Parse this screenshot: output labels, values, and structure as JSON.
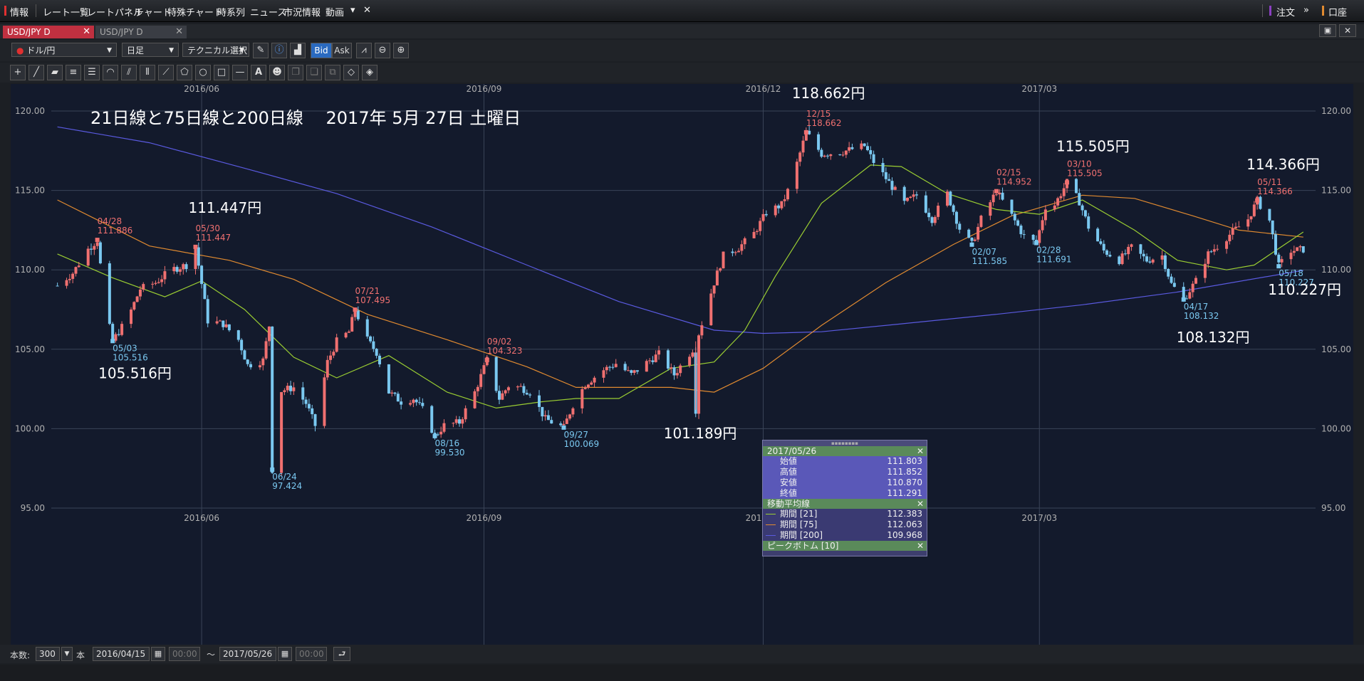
{
  "menu": {
    "items": [
      "情報",
      "レート一覧",
      "レートパネル",
      "チャート",
      "特殊チャート",
      "時系列",
      "ニュース",
      "市況情報",
      "動画"
    ],
    "right_items": [
      "注文",
      "口座"
    ]
  },
  "tabs": [
    {
      "label": "USD/JPY D",
      "active": true
    },
    {
      "label": "USD/JPY D",
      "active": false
    }
  ],
  "toolbar": {
    "pair_select": "ドル/円",
    "period_select": "日足",
    "technical_select": "テクニカル選択",
    "bid_label": "Bid",
    "ask_label": "Ask"
  },
  "status": {
    "count_label": "本数:",
    "count_value": "300",
    "count_unit": "本",
    "from_date": "2016/04/15",
    "from_time": "00:00",
    "tilde": "〜",
    "to_date": "2017/05/26",
    "to_time": "00:00"
  },
  "panel": {
    "date": "2017/05/26",
    "ohlc": [
      {
        "label": "始値",
        "value": "111.803"
      },
      {
        "label": "高値",
        "value": "111.852"
      },
      {
        "label": "安値",
        "value": "110.870"
      },
      {
        "label": "終値",
        "value": "111.291"
      }
    ],
    "ma_title": "移動平均線",
    "ma_rows": [
      {
        "label": "期間 [21]",
        "value": "112.383",
        "color": "#9acd32"
      },
      {
        "label": "期間 [75]",
        "value": "112.063",
        "color": "#e08a30"
      },
      {
        "label": "期間 [200]",
        "value": "109.968",
        "color": "#5a5ae0"
      }
    ],
    "peak_title": "ピークボトム [10]"
  },
  "chart_data": {
    "type": "candlestick",
    "title": "21日線と75日線と200日線　 2017年 5月 27日 土曜日",
    "ylim": [
      95,
      121.5
    ],
    "y_ticks": [
      "95.00",
      "100.00",
      "105.00",
      "110.00",
      "115.00",
      "120.00"
    ],
    "x_ticks": [
      "2016/06",
      "2016/09",
      "2016/12",
      "2017/03"
    ],
    "grid": true,
    "up_color": "#f07070",
    "down_color": "#7ac8f0",
    "ma_colors": {
      "ma21": "#9acd32",
      "ma75": "#e08a30",
      "ma200": "#5a5ae0"
    },
    "price_path": [
      [
        "2016-04-15",
        109.0
      ],
      [
        "2016-04-20",
        109.8
      ],
      [
        "2016-04-25",
        111.3
      ],
      [
        "2016-04-28",
        111.886
      ],
      [
        "2016-05-01",
        107.2
      ],
      [
        "2016-05-03",
        105.516
      ],
      [
        "2016-05-08",
        107.0
      ],
      [
        "2016-05-12",
        108.8
      ],
      [
        "2016-05-17",
        109.2
      ],
      [
        "2016-05-22",
        110.0
      ],
      [
        "2016-05-27",
        110.3
      ],
      [
        "2016-05-30",
        111.447
      ],
      [
        "2016-06-03",
        106.8
      ],
      [
        "2016-06-08",
        106.6
      ],
      [
        "2016-06-13",
        105.6
      ],
      [
        "2016-06-16",
        104.0
      ],
      [
        "2016-06-21",
        104.3
      ],
      [
        "2016-06-23",
        106.5
      ],
      [
        "2016-06-24",
        97.424
      ],
      [
        "2016-06-27",
        102.4
      ],
      [
        "2016-07-01",
        102.6
      ],
      [
        "2016-07-05",
        101.6
      ],
      [
        "2016-07-08",
        100.2
      ],
      [
        "2016-07-12",
        104.2
      ],
      [
        "2016-07-15",
        105.5
      ],
      [
        "2016-07-19",
        106.1
      ],
      [
        "2016-07-21",
        107.495
      ],
      [
        "2016-07-25",
        105.6
      ],
      [
        "2016-07-28",
        104.8
      ],
      [
        "2016-08-01",
        102.3
      ],
      [
        "2016-08-05",
        101.7
      ],
      [
        "2016-08-09",
        101.9
      ],
      [
        "2016-08-12",
        101.2
      ],
      [
        "2016-08-16",
        99.53
      ],
      [
        "2016-08-19",
        100.2
      ],
      [
        "2016-08-24",
        100.4
      ],
      [
        "2016-08-29",
        102.3
      ],
      [
        "2016-09-02",
        104.323
      ],
      [
        "2016-09-06",
        101.9
      ],
      [
        "2016-09-09",
        102.7
      ],
      [
        "2016-09-13",
        102.6
      ],
      [
        "2016-09-16",
        102.3
      ],
      [
        "2016-09-21",
        100.6
      ],
      [
        "2016-09-27",
        100.069
      ],
      [
        "2016-09-30",
        101.5
      ],
      [
        "2016-10-04",
        102.8
      ],
      [
        "2016-10-10",
        103.7
      ],
      [
        "2016-10-14",
        104.1
      ],
      [
        "2016-10-19",
        103.4
      ],
      [
        "2016-10-25",
        104.3
      ],
      [
        "2016-10-28",
        104.7
      ],
      [
        "2016-11-02",
        103.4
      ],
      [
        "2016-11-08",
        105.0
      ],
      [
        "2016-11-09",
        101.189
      ],
      [
        "2016-11-10",
        106.0
      ],
      [
        "2016-11-15",
        109.2
      ],
      [
        "2016-11-18",
        110.9
      ],
      [
        "2016-11-23",
        111.4
      ],
      [
        "2016-11-28",
        112.3
      ],
      [
        "2016-12-02",
        113.6
      ],
      [
        "2016-12-07",
        114.1
      ],
      [
        "2016-12-10",
        115.4
      ],
      [
        "2016-12-15",
        118.662
      ],
      [
        "2016-12-20",
        117.3
      ],
      [
        "2016-12-26",
        117.4
      ],
      [
        "2017-01-03",
        117.8
      ],
      [
        "2017-01-06",
        116.8
      ],
      [
        "2017-01-11",
        115.5
      ],
      [
        "2017-01-16",
        114.2
      ],
      [
        "2017-01-20",
        114.7
      ],
      [
        "2017-01-25",
        113.2
      ],
      [
        "2017-01-30",
        114.8
      ],
      [
        "2017-02-03",
        112.6
      ],
      [
        "2017-02-07",
        111.585
      ],
      [
        "2017-02-10",
        113.2
      ],
      [
        "2017-02-15",
        114.952
      ],
      [
        "2017-02-20",
        113.4
      ],
      [
        "2017-02-24",
        112.1
      ],
      [
        "2017-02-28",
        111.691
      ],
      [
        "2017-03-03",
        114.0
      ],
      [
        "2017-03-06",
        114.1
      ],
      [
        "2017-03-10",
        115.505
      ],
      [
        "2017-03-14",
        114.3
      ],
      [
        "2017-03-17",
        112.7
      ],
      [
        "2017-03-22",
        111.2
      ],
      [
        "2017-03-27",
        110.6
      ],
      [
        "2017-03-31",
        111.4
      ],
      [
        "2017-04-05",
        110.6
      ],
      [
        "2017-04-10",
        110.9
      ],
      [
        "2017-04-13",
        109.1
      ],
      [
        "2017-04-17",
        108.132
      ],
      [
        "2017-04-21",
        109.3
      ],
      [
        "2017-04-25",
        111.0
      ],
      [
        "2017-04-28",
        111.5
      ],
      [
        "2017-05-03",
        112.4
      ],
      [
        "2017-05-08",
        113.2
      ],
      [
        "2017-05-11",
        114.366
      ],
      [
        "2017-05-15",
        113.1
      ],
      [
        "2017-05-18",
        110.227
      ],
      [
        "2017-05-22",
        111.2
      ],
      [
        "2017-05-26",
        111.291
      ]
    ],
    "ma21_path": [
      [
        "2016-04-15",
        111.0
      ],
      [
        "2016-05-03",
        109.5
      ],
      [
        "2016-05-20",
        108.3
      ],
      [
        "2016-06-01",
        109.3
      ],
      [
        "2016-06-15",
        107.5
      ],
      [
        "2016-07-01",
        104.5
      ],
      [
        "2016-07-15",
        103.2
      ],
      [
        "2016-08-01",
        104.6
      ],
      [
        "2016-08-20",
        102.3
      ],
      [
        "2016-09-05",
        101.3
      ],
      [
        "2016-09-20",
        101.7
      ],
      [
        "2016-10-01",
        101.9
      ],
      [
        "2016-10-15",
        101.9
      ],
      [
        "2016-11-01",
        103.8
      ],
      [
        "2016-11-15",
        104.2
      ],
      [
        "2016-11-25",
        106.2
      ],
      [
        "2016-12-05",
        109.6
      ],
      [
        "2016-12-20",
        114.2
      ],
      [
        "2017-01-05",
        116.6
      ],
      [
        "2017-01-15",
        116.5
      ],
      [
        "2017-01-30",
        114.8
      ],
      [
        "2017-02-15",
        113.8
      ],
      [
        "2017-03-01",
        113.5
      ],
      [
        "2017-03-15",
        114.4
      ],
      [
        "2017-04-01",
        112.5
      ],
      [
        "2017-04-15",
        110.6
      ],
      [
        "2017-05-01",
        110.0
      ],
      [
        "2017-05-10",
        110.3
      ],
      [
        "2017-05-26",
        112.383
      ]
    ],
    "ma75_path": [
      [
        "2016-04-15",
        114.4
      ],
      [
        "2016-05-15",
        111.5
      ],
      [
        "2016-06-10",
        110.6
      ],
      [
        "2016-07-01",
        109.4
      ],
      [
        "2016-07-25",
        107.2
      ],
      [
        "2016-08-20",
        105.6
      ],
      [
        "2016-09-15",
        103.9
      ],
      [
        "2016-10-01",
        102.6
      ],
      [
        "2016-11-01",
        102.6
      ],
      [
        "2016-11-15",
        102.3
      ],
      [
        "2016-12-01",
        103.8
      ],
      [
        "2016-12-20",
        106.5
      ],
      [
        "2017-01-10",
        109.2
      ],
      [
        "2017-02-01",
        111.6
      ],
      [
        "2017-02-20",
        113.4
      ],
      [
        "2017-03-15",
        114.7
      ],
      [
        "2017-04-01",
        114.5
      ],
      [
        "2017-04-20",
        113.4
      ],
      [
        "2017-05-05",
        112.5
      ],
      [
        "2017-05-26",
        112.063
      ]
    ],
    "ma200_path": [
      [
        "2016-04-15",
        119.0
      ],
      [
        "2016-05-15",
        118.0
      ],
      [
        "2016-06-15",
        116.4
      ],
      [
        "2016-07-15",
        114.8
      ],
      [
        "2016-08-15",
        112.7
      ],
      [
        "2016-09-15",
        110.3
      ],
      [
        "2016-10-15",
        108.0
      ],
      [
        "2016-11-15",
        106.2
      ],
      [
        "2016-12-01",
        106.0
      ],
      [
        "2016-12-20",
        106.1
      ],
      [
        "2017-01-15",
        106.6
      ],
      [
        "2017-02-15",
        107.2
      ],
      [
        "2017-03-15",
        107.8
      ],
      [
        "2017-04-15",
        108.6
      ],
      [
        "2017-05-26",
        109.968
      ]
    ],
    "peak_labels": [
      {
        "date": "04/28",
        "value": "111.886",
        "dx": "2016-04-28",
        "kind": "peak"
      },
      {
        "date": "05/03",
        "value": "105.516",
        "dx": "2016-05-03",
        "kind": "bottom"
      },
      {
        "date": "05/30",
        "value": "111.447",
        "dx": "2016-05-30",
        "kind": "peak"
      },
      {
        "date": "06/24",
        "value": "97.424",
        "dx": "2016-06-24",
        "kind": "bottom"
      },
      {
        "date": "07/21",
        "value": "107.495",
        "dx": "2016-07-21",
        "kind": "peak"
      },
      {
        "date": "08/16",
        "value": "99.530",
        "dx": "2016-08-16",
        "kind": "bottom"
      },
      {
        "date": "09/02",
        "value": "104.323",
        "dx": "2016-09-02",
        "kind": "peak"
      },
      {
        "date": "09/27",
        "value": "100.069",
        "dx": "2016-09-27",
        "kind": "bottom"
      },
      {
        "date": "12/15",
        "value": "118.662",
        "dx": "2016-12-15",
        "kind": "peak"
      },
      {
        "date": "02/07",
        "value": "111.585",
        "dx": "2017-02-07",
        "kind": "bottom"
      },
      {
        "date": "02/15",
        "value": "114.952",
        "dx": "2017-02-15",
        "kind": "peak"
      },
      {
        "date": "02/28",
        "value": "111.691",
        "dx": "2017-02-28",
        "kind": "bottom"
      },
      {
        "date": "03/10",
        "value": "115.505",
        "dx": "2017-03-10",
        "kind": "peak"
      },
      {
        "date": "04/17",
        "value": "108.132",
        "dx": "2017-04-17",
        "kind": "bottom"
      },
      {
        "date": "05/11",
        "value": "114.366",
        "dx": "2017-05-11",
        "kind": "peak"
      },
      {
        "date": "05/18",
        "value": "110.227",
        "dx": "2017-05-18",
        "kind": "bottom"
      }
    ],
    "annotations": [
      {
        "text": "111.447円",
        "dx": "2016-05-30",
        "dy": 111.447,
        "side": "above"
      },
      {
        "text": "105.516円",
        "dx": "2016-05-03",
        "dy": 105.516,
        "side": "below"
      },
      {
        "text": "118.662円",
        "dx": "2016-12-15",
        "dy": 118.662,
        "side": "above"
      },
      {
        "text": "101.189円",
        "dx": "2016-11-09",
        "dy": 101.189,
        "side": "below"
      },
      {
        "text": "115.505円",
        "dx": "2017-03-10",
        "dy": 115.505,
        "side": "above"
      },
      {
        "text": "114.366円",
        "dx": "2017-05-11",
        "dy": 114.366,
        "side": "above"
      },
      {
        "text": "108.132円",
        "dx": "2017-04-17",
        "dy": 108.132,
        "side": "below"
      },
      {
        "text": "110.227円",
        "dx": "2017-05-18",
        "dy": 110.227,
        "side": "below"
      }
    ]
  }
}
